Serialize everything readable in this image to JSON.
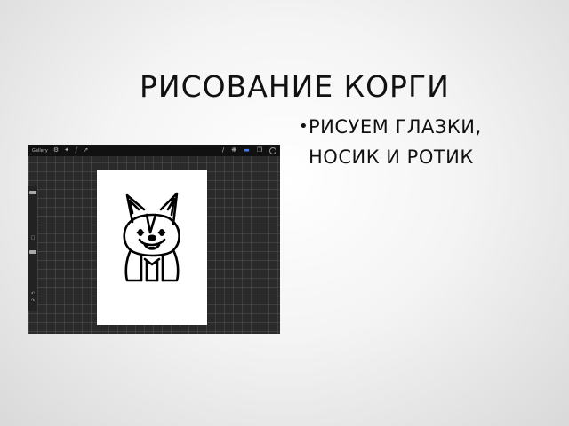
{
  "slide": {
    "title": "РИСОВАНИЕ КОРГИ",
    "bullets": [
      {
        "line1": "РИСУЕМ ГЛАЗКИ,",
        "line2": "НОСИК И РОТИК"
      }
    ]
  },
  "app_screenshot": {
    "toolbar": {
      "gallery_label": "Gallery",
      "left_icons": [
        "wrench-icon",
        "magic-wand-icon",
        "selection-icon",
        "transform-arrow-icon"
      ],
      "right_icons": [
        "brush-icon",
        "smudge-icon",
        "eraser-icon",
        "layers-icon",
        "color-swatch-icon"
      ]
    },
    "sidebar": {
      "controls": [
        "brush-size-slider",
        "modify-button",
        "opacity-slider",
        "undo-button",
        "redo-button"
      ]
    },
    "canvas": {
      "background": "#ffffff",
      "drawing": "corgi-sketch"
    }
  },
  "colors": {
    "text": "#111111",
    "app_background": "#2a2a2a",
    "toolbar": "#111111",
    "active_tool": "#3a7bff"
  }
}
